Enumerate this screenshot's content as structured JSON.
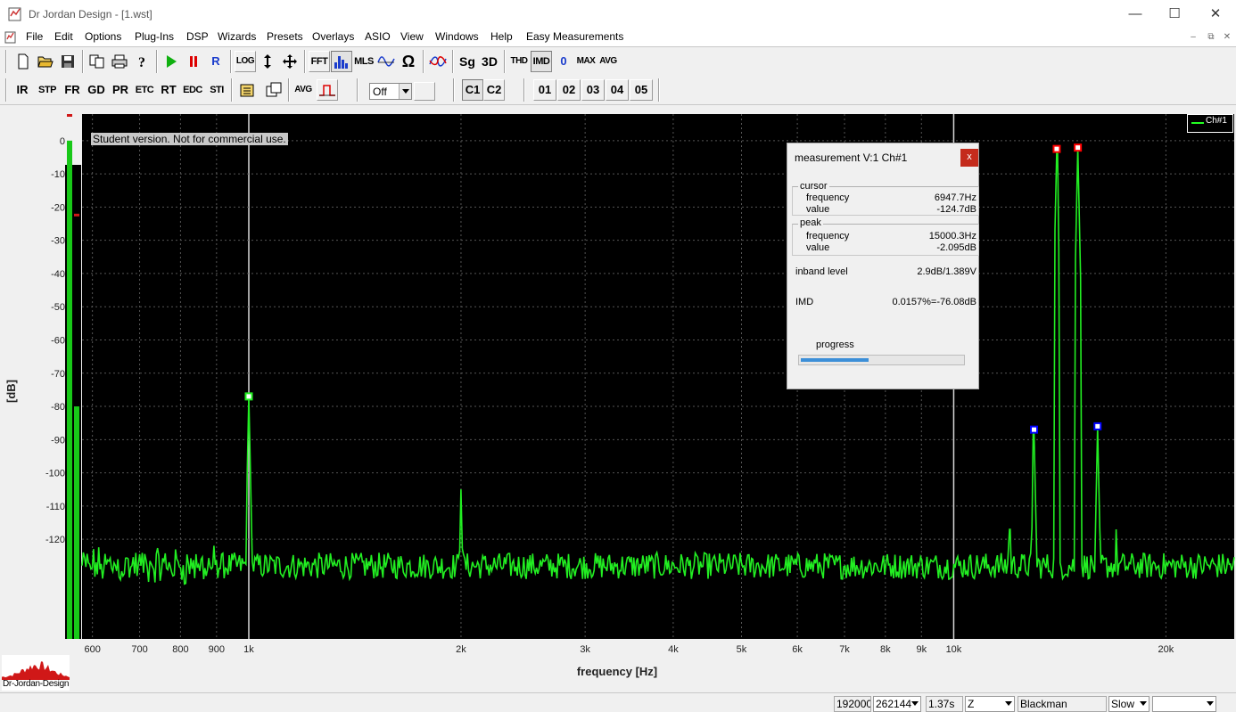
{
  "window": {
    "title": "Dr Jordan Design - [1.wst]",
    "minimize": "—",
    "maximize": "☐",
    "close": "✕"
  },
  "menu": {
    "items": [
      "File",
      "Edit",
      "Options",
      "Plug-Ins",
      "DSP",
      "Wizards",
      "Presets",
      "Overlays",
      "ASIO",
      "View",
      "Windows",
      "Help",
      "Easy Measurements"
    ],
    "mdi_min": "–",
    "mdi_restore": "⧉",
    "mdi_close": "✕"
  },
  "toolbar1": {
    "log": "LOG",
    "fft": "FFT",
    "mls": "MLS",
    "omega": "Ω",
    "sg": "Sg",
    "three_d": "3D",
    "thd": "THD",
    "imd": "IMD",
    "zero": "0",
    "max": "MAX",
    "avg": "AVG",
    "record": "R"
  },
  "toolbar2": {
    "ir": "IR",
    "stp": "STP",
    "fr": "FR",
    "gd": "GD",
    "pr": "PR",
    "etc": "ETC",
    "rt": "RT",
    "edc": "EDC",
    "sti": "STI",
    "avg": "AVG",
    "off_select": "Off",
    "c1": "C1",
    "c2": "C2",
    "overlays": [
      "01",
      "02",
      "03",
      "04",
      "05"
    ]
  },
  "plot": {
    "student_note": "Student version. Not for commercial use.",
    "legend_label": "Ch#1",
    "colors": {
      "background": "#000000",
      "trace": "#22ee22",
      "grid": "#555555",
      "peak_marker": "#ff0000",
      "imd_marker": "#0000ff"
    }
  },
  "chart_data": {
    "type": "line",
    "title": "",
    "xlabel": "frequency [Hz]",
    "ylabel": "[dB]",
    "x_scale": "log",
    "xlim": [
      580,
      25000
    ],
    "ylim": [
      -150,
      8
    ],
    "x_ticks": [
      {
        "value": 600,
        "label": "600"
      },
      {
        "value": 700,
        "label": "700"
      },
      {
        "value": 800,
        "label": "800"
      },
      {
        "value": 900,
        "label": "900"
      },
      {
        "value": 1000,
        "label": "1k"
      },
      {
        "value": 2000,
        "label": "2k"
      },
      {
        "value": 3000,
        "label": "3k"
      },
      {
        "value": 4000,
        "label": "4k"
      },
      {
        "value": 5000,
        "label": "5k"
      },
      {
        "value": 6000,
        "label": "6k"
      },
      {
        "value": 7000,
        "label": "7k"
      },
      {
        "value": 8000,
        "label": "8k"
      },
      {
        "value": 9000,
        "label": "9k"
      },
      {
        "value": 10000,
        "label": "10k"
      },
      {
        "value": 20000,
        "label": "20k"
      }
    ],
    "y_ticks": [
      0,
      -10,
      -20,
      -30,
      -40,
      -50,
      -60,
      -70,
      -80,
      -90,
      -100,
      -110,
      -120
    ],
    "noise_floor_db": -128,
    "peaks": [
      {
        "freq": 1000,
        "db": -77,
        "marker": "white"
      },
      {
        "freq": 2000,
        "db": -105,
        "marker": "none"
      },
      {
        "freq": 12000,
        "db": -117,
        "marker": "none"
      },
      {
        "freq": 13000,
        "db": -87,
        "marker": "blue"
      },
      {
        "freq": 14000,
        "db": -2.5,
        "marker": "red"
      },
      {
        "freq": 15000,
        "db": -2.1,
        "marker": "red"
      },
      {
        "freq": 16000,
        "db": -86,
        "marker": "blue"
      },
      {
        "freq": 17000,
        "db": -117,
        "marker": "none"
      }
    ],
    "cursor_freq": 1000,
    "grid": true,
    "legend": "top-right",
    "series": [
      {
        "name": "Ch#1"
      }
    ]
  },
  "meter": {
    "bar_level_db": 0,
    "bar2_level_db": -80,
    "peak_hold_db": -22,
    "top_hold_db": 8
  },
  "dialog": {
    "title": "measurement V:1 Ch#1",
    "close": "x",
    "cursor_group": "cursor",
    "cursor_frequency_label": "frequency",
    "cursor_frequency_value": "6947.7Hz",
    "cursor_value_label": "value",
    "cursor_value_value": "-124.7dB",
    "peak_group": "peak",
    "peak_frequency_label": "frequency",
    "peak_frequency_value": "15000.3Hz",
    "peak_value_label": "value",
    "peak_value_value": "-2.095dB",
    "inband_label": "inband level",
    "inband_value": "2.9dB/1.389V",
    "imd_label": "IMD",
    "imd_value": "0.0157%=-76.08dB",
    "progress_label": "progress",
    "progress_fraction": 0.42
  },
  "logo_text": "Dr-Jordan-Design",
  "statusbar": {
    "sample_rate": "192000",
    "fft_size": "262144",
    "duration": "1.37s",
    "weighting": "Z",
    "window": "Blackman",
    "speed": "Slow",
    "extra": ""
  }
}
